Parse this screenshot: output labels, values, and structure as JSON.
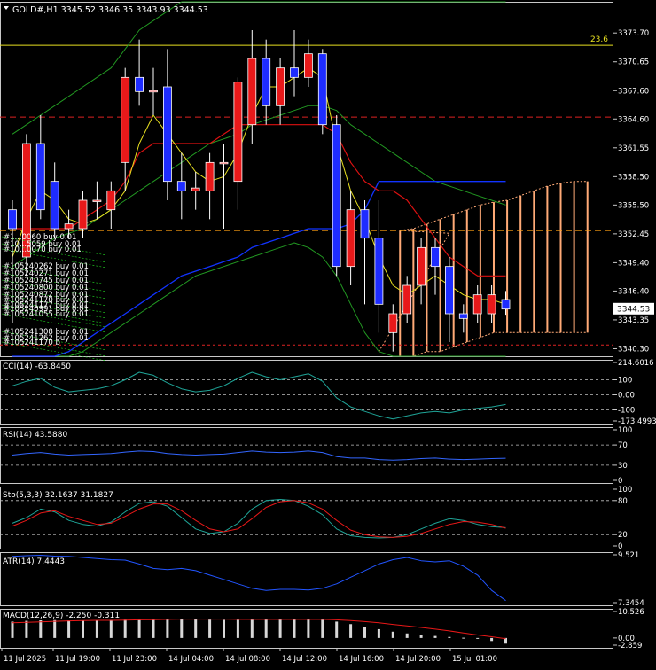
{
  "colors": {
    "bg": "#000000",
    "grid": "#c0c0c0",
    "frame": "#c8c8c8",
    "axis_text": "#ffffff",
    "bull": "#e8191a",
    "bear": "#1e2cff",
    "wick": "#ffffff",
    "kumo": "#ffaa77",
    "boll": "#229922",
    "fast_ma": "#e8e020",
    "kijun": "#dd1111",
    "tenkan": "#1133ff",
    "cci_line": "#1fa598",
    "rsi_line": "#3366ff",
    "stoch_main": "#1fa598",
    "stoch_signal": "#e81818",
    "atr_line": "#2255ff",
    "macd_hist": "#d8d8d8",
    "macd_signal": "#e81818",
    "trade_label": "#ffffff",
    "trade_green": "#22dd22",
    "level_yellow": "#e8e020",
    "level_red": "#dd2222",
    "level_orange": "#ffa010",
    "price_box_bg": "#ffffff",
    "price_box_text": "#000000"
  },
  "main": {
    "header": "GOLD#,H1  3345.52 3346.35 3343.93 3344.53",
    "symbol": "GOLD#,H1",
    "ohlc": "3345.52 3346.35 3343.93 3344.53",
    "last_price": "3344.53",
    "price_range": [
      3339.5,
      3377.0
    ],
    "price_ticks": [
      "3373.70",
      "3370.65",
      "3367.60",
      "3364.60",
      "3361.55",
      "3358.50",
      "3355.50",
      "3352.45",
      "3349.40",
      "3346.40",
      "3343.35",
      "3340.30"
    ],
    "level_label": "23.6",
    "levels": {
      "yellow_solid": 3372.4,
      "red_dashed": 3364.8,
      "orange_dashed": 3352.8,
      "red_dotted_bottom": 3340.7
    },
    "trade_labels": [
      "#1...0060 buy 0.01",
      "#10...5059 buy 0.01",
      "#10...0070 buy 0.01",
      "#105240262 buy 0.01",
      "#105240271 buy 0.01",
      "#105240745 buy 0.01",
      "#105240800 buy 0.01",
      "#105240872 buy 0.01",
      "#105241170 buy 0.01",
      "#105241177 buy 0.01",
      "#105240991 buy 0.01",
      "#105241055 buy 0.01",
      "#105241308 buy 0.01",
      "#105241262 buy 0.01",
      "#105241170 b"
    ],
    "candles": [
      [
        3355,
        3353,
        3356,
        3343
      ],
      [
        3350,
        3362,
        3363,
        3348
      ],
      [
        3362,
        3355,
        3365,
        3354
      ],
      [
        3358,
        3353,
        3360,
        3352
      ],
      [
        3353,
        3353.5,
        3355,
        3352
      ],
      [
        3353,
        3356,
        3357,
        3352
      ],
      [
        3356,
        3356,
        3358,
        3354
      ],
      [
        3355,
        3357,
        3358,
        3353
      ],
      [
        3360,
        3369,
        3370,
        3357
      ],
      [
        3369,
        3367.5,
        3373,
        3366
      ],
      [
        3367.5,
        3367.6,
        3370,
        3365
      ],
      [
        3368,
        3358,
        3372,
        3356
      ],
      [
        3358,
        3357,
        3361,
        3354
      ],
      [
        3357,
        3357.3,
        3359,
        3355
      ],
      [
        3357,
        3360,
        3361,
        3354
      ],
      [
        3360,
        3360,
        3362,
        3353
      ],
      [
        3358,
        3368.5,
        3369,
        3355
      ],
      [
        3364,
        3371,
        3374,
        3362
      ],
      [
        3371,
        3366,
        3373,
        3364
      ],
      [
        3366,
        3370,
        3371,
        3364
      ],
      [
        3370,
        3369,
        3374,
        3367
      ],
      [
        3369,
        3371.5,
        3373,
        3368
      ],
      [
        3371.5,
        3364,
        3372,
        3363
      ],
      [
        3364,
        3349,
        3365,
        3348
      ],
      [
        3349,
        3355,
        3357,
        3347
      ],
      [
        3355,
        3352,
        3356,
        3345
      ],
      [
        3352,
        3345,
        3356,
        3342
      ],
      [
        3342,
        3344,
        3345,
        3340
      ],
      [
        3344,
        3347,
        3348,
        3343
      ],
      [
        3347,
        3351,
        3352,
        3345
      ],
      [
        3351,
        3349,
        3352,
        3346
      ],
      [
        3349,
        3344,
        3350,
        3341
      ],
      [
        3344,
        3343.5,
        3345,
        3342
      ],
      [
        3344,
        3346,
        3347,
        3343
      ],
      [
        3344,
        3346,
        3347,
        3343
      ],
      [
        3345.5,
        3344.5,
        3346.4,
        3343.9
      ]
    ],
    "boll_upper": [
      3363,
      3364,
      3365,
      3366,
      3367,
      3368,
      3369,
      3370,
      3372,
      3374,
      3375,
      3376,
      3377,
      3377,
      3378,
      3378,
      3379,
      3380,
      3380,
      3380,
      3381,
      3382,
      3383,
      3384,
      3385,
      3385,
      3385,
      3384,
      3383,
      3381,
      3380,
      3379,
      3378,
      3377.5,
      3377,
      3377
    ],
    "boll_mid": [
      3349,
      3350,
      3351,
      3352,
      3352.5,
      3353,
      3354,
      3355,
      3356,
      3357,
      3358,
      3359,
      3360,
      3361,
      3362,
      3362.5,
      3363,
      3364,
      3364.5,
      3365,
      3365.5,
      3366,
      3366,
      3365.5,
      3364,
      3363,
      3362,
      3361,
      3360,
      3359,
      3358,
      3357.5,
      3357,
      3356.5,
      3356,
      3355.5
    ],
    "boll_lower": [
      3335,
      3336,
      3337,
      3338,
      3339,
      3340,
      3341,
      3342,
      3343,
      3344,
      3345,
      3346,
      3347,
      3348,
      3348.5,
      3349,
      3349.5,
      3350,
      3350.5,
      3351,
      3351.5,
      3351,
      3350,
      3348,
      3345,
      3342,
      3340,
      3338,
      3336.5,
      3335,
      3334,
      3333.5,
      3333,
      3333,
      3333,
      3333
    ],
    "fast_ma": [
      3350,
      3354,
      3357,
      3356,
      3354,
      3353.5,
      3354,
      3355,
      3357,
      3362,
      3365,
      3363,
      3361,
      3359,
      3358,
      3358.5,
      3361,
      3365,
      3368,
      3368,
      3369,
      3370,
      3369,
      3362,
      3357,
      3354,
      3350,
      3347,
      3346,
      3347,
      3348,
      3347,
      3346,
      3345.5,
      3345.5,
      3345
    ],
    "kijun": [
      3353,
      3353,
      3353,
      3353,
      3353,
      3354,
      3355,
      3356,
      3358,
      3361,
      3362,
      3362,
      3362,
      3362,
      3362,
      3363,
      3364,
      3364,
      3364,
      3364,
      3364,
      3364,
      3364,
      3363,
      3360,
      3358,
      3357,
      3357,
      3356,
      3354,
      3352,
      3350,
      3349,
      3348,
      3348,
      3348
    ],
    "tenkan": [
      3337,
      3338,
      3339,
      3339.5,
      3340,
      3341,
      3342,
      3343,
      3344,
      3345,
      3346,
      3347,
      3348,
      3348.5,
      3349,
      3349.5,
      3350,
      3351,
      3351.5,
      3352,
      3352.5,
      3353,
      3353,
      3353,
      3353.5,
      3355,
      3358,
      3358,
      3358,
      3358,
      3358,
      3358,
      3358,
      3358,
      3358,
      3358
    ],
    "kumo_top": [
      3352.8,
      3353,
      3353.5,
      3354,
      3354.5,
      3355,
      3355.5,
      3355.8,
      3356,
      3356.5,
      3357,
      3357.5,
      3357.8,
      3358,
      3358
    ],
    "kumo_bottom": [
      3338,
      3339,
      3340,
      3340,
      3340.5,
      3341,
      3341.5,
      3342,
      3342,
      3342,
      3342,
      3342,
      3342,
      3342,
      3342
    ]
  },
  "cci": {
    "label": "CCI(14) -63.8450",
    "ticks": [
      "214.6016",
      "100",
      "0.00",
      "-100",
      "-173.4993"
    ],
    "range": [
      -173.4993,
      214.6016
    ],
    "values": [
      60,
      90,
      110,
      50,
      20,
      30,
      40,
      60,
      100,
      150,
      130,
      80,
      40,
      20,
      30,
      60,
      110,
      150,
      120,
      100,
      120,
      140,
      90,
      -20,
      -80,
      -110,
      -140,
      -160,
      -140,
      -120,
      -110,
      -120,
      -100,
      -90,
      -80,
      -64
    ]
  },
  "rsi": {
    "label": "RSI(14) 43.5880",
    "ticks": [
      "100",
      "70",
      "30",
      "0"
    ],
    "range": [
      0,
      100
    ],
    "values": [
      50,
      53,
      55,
      52,
      50,
      51,
      52,
      53,
      56,
      58,
      57,
      53,
      51,
      50,
      51,
      52,
      55,
      58,
      56,
      55,
      56,
      58,
      55,
      47,
      44,
      44,
      41,
      40,
      41,
      43,
      44,
      42,
      41,
      42,
      43,
      43.6
    ]
  },
  "stoch": {
    "label": "Sto(5,3,3) 32.1637 31.1827",
    "ticks": [
      "100",
      "80",
      "20",
      "0"
    ],
    "range": [
      0,
      100
    ],
    "main": [
      40,
      50,
      65,
      60,
      45,
      38,
      35,
      42,
      60,
      75,
      78,
      70,
      50,
      30,
      22,
      25,
      40,
      65,
      80,
      82,
      80,
      70,
      55,
      30,
      18,
      15,
      14,
      15,
      20,
      30,
      40,
      48,
      45,
      38,
      34,
      32.2
    ],
    "signal": [
      35,
      45,
      58,
      62,
      52,
      45,
      38,
      40,
      52,
      65,
      74,
      74,
      62,
      45,
      30,
      25,
      30,
      48,
      68,
      78,
      80,
      76,
      65,
      45,
      28,
      20,
      16,
      15,
      17,
      22,
      30,
      38,
      43,
      42,
      38,
      31.2
    ]
  },
  "atr": {
    "label": "ATR(14) 7.4443",
    "ticks": [
      "9.521",
      "7.3454"
    ],
    "range": [
      7.3454,
      9.521
    ],
    "values": [
      9.45,
      9.48,
      9.5,
      9.46,
      9.45,
      9.4,
      9.35,
      9.3,
      9.28,
      9.1,
      8.9,
      8.85,
      8.9,
      8.8,
      8.6,
      8.4,
      8.2,
      8.0,
      7.9,
      7.95,
      7.95,
      7.92,
      8.0,
      8.2,
      8.5,
      8.8,
      9.1,
      9.3,
      9.4,
      9.25,
      9.2,
      9.25,
      9.0,
      8.6,
      7.9,
      7.44
    ]
  },
  "macd": {
    "label": "MACD(12,26,9) -2.250 -0.311",
    "ticks": [
      "10.526",
      "0.00",
      "-2.859"
    ],
    "range": [
      -2.859,
      10.526
    ],
    "hist": [
      6.5,
      6.8,
      7.0,
      7.1,
      7.0,
      7.0,
      7.1,
      7.2,
      7.3,
      7.5,
      7.6,
      7.6,
      7.5,
      7.4,
      7.3,
      7.2,
      7.2,
      7.3,
      7.4,
      7.4,
      7.4,
      7.5,
      7.3,
      6.5,
      5.5,
      4.5,
      3.5,
      2.5,
      1.8,
      1.2,
      0.8,
      0.4,
      0.1,
      -0.3,
      -1.2,
      -2.25
    ],
    "signal": [
      6.0,
      6.2,
      6.4,
      6.6,
      6.8,
      6.9,
      7.0,
      7.0,
      7.1,
      7.2,
      7.3,
      7.4,
      7.5,
      7.5,
      7.5,
      7.5,
      7.4,
      7.4,
      7.4,
      7.4,
      7.4,
      7.4,
      7.4,
      7.2,
      6.9,
      6.5,
      6.0,
      5.4,
      4.8,
      4.2,
      3.5,
      2.8,
      2.0,
      1.2,
      0.5,
      -0.31
    ]
  },
  "time_labels": [
    "11 Jul 2025",
    "11 Jul 19:00",
    "11 Jul 23:00",
    "14 Jul 04:00",
    "14 Jul 08:00",
    "14 Jul 12:00",
    "14 Jul 16:00",
    "14 Jul 20:00",
    "15 Jul 01:00"
  ]
}
